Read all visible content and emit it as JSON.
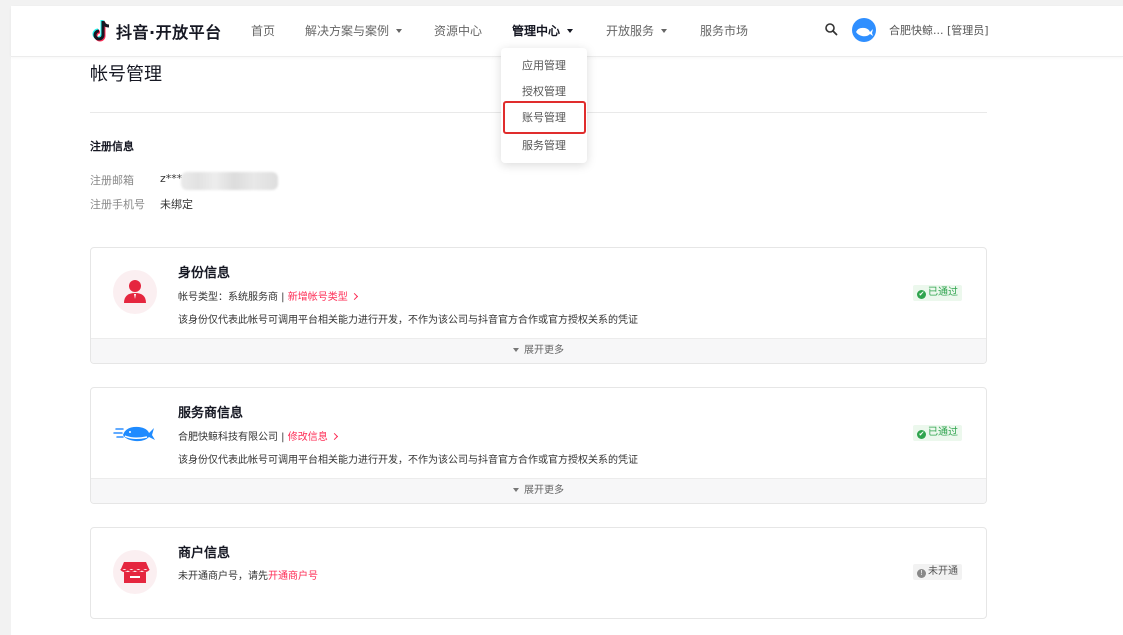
{
  "header": {
    "logo_text": "抖音·开放平台",
    "nav": [
      {
        "label": "首页"
      },
      {
        "label": "解决方案与案例"
      },
      {
        "label": "资源中心"
      },
      {
        "label": "管理中心"
      },
      {
        "label": "开放服务"
      },
      {
        "label": "服务市场"
      }
    ],
    "user_label": "合肥快鲸... [管理员]"
  },
  "dropdown": {
    "items": [
      {
        "label": "应用管理"
      },
      {
        "label": "授权管理"
      },
      {
        "label": "账号管理"
      },
      {
        "label": "服务管理"
      }
    ],
    "highlight_color": "#e02d2d"
  },
  "page": {
    "title": "帐号管理",
    "registration": {
      "section_title": "注册信息",
      "email_label": "注册邮箱",
      "email_value": "z***",
      "phone_label": "注册手机号",
      "phone_value": "未绑定"
    }
  },
  "cards": [
    {
      "title": "身份信息",
      "line1_prefix": "帐号类型：系统服务商 | ",
      "line1_link": "新增帐号类型",
      "line2": "该身份仅代表此帐号可调用平台相关能力进行开发，不作为该公司与抖音官方合作或官方授权关系的凭证",
      "status": "已通过",
      "expand": "展开更多",
      "icon": "user-icon"
    },
    {
      "title": "服务商信息",
      "line1_prefix": "合肥快鲸科技有限公司 | ",
      "line1_link": "修改信息",
      "line2": "该身份仅代表此帐号可调用平台相关能力进行开发，不作为该公司与抖音官方合作或官方授权关系的凭证",
      "status": "已通过",
      "expand": "展开更多",
      "icon": "whale-icon"
    },
    {
      "title": "商户信息",
      "line1_prefix": "未开通商户号，请先",
      "line1_link": "开通商户号",
      "status": "未开通",
      "icon": "store-icon"
    }
  ],
  "colors": {
    "accent": "#fe2c55",
    "success": "#2fa44e",
    "avatar": "#2f8fff"
  }
}
